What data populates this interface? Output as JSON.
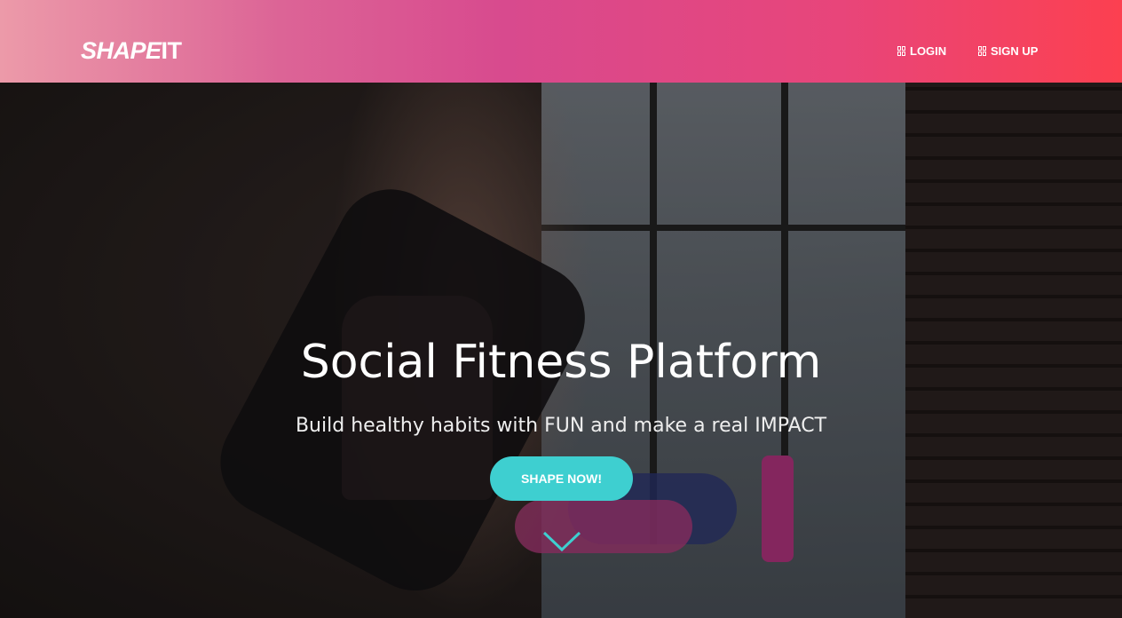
{
  "header": {
    "logo": {
      "part1": "SHAPE",
      "part2": "IT"
    },
    "nav": [
      {
        "label": "LOGIN",
        "icon": "dashboard-icon"
      },
      {
        "label": "SIGN UP",
        "icon": "dashboard-icon"
      }
    ]
  },
  "hero": {
    "title": "Social Fitness Platform",
    "subtitle": "Build healthy habits with FUN and make a real IMPACT",
    "cta": "SHAPE NOW!",
    "scroll_icon": "chevron-down-icon"
  },
  "colors": {
    "accent": "#3ecfd0",
    "header_start": "#ec9aa9",
    "header_end": "#fc4050"
  }
}
